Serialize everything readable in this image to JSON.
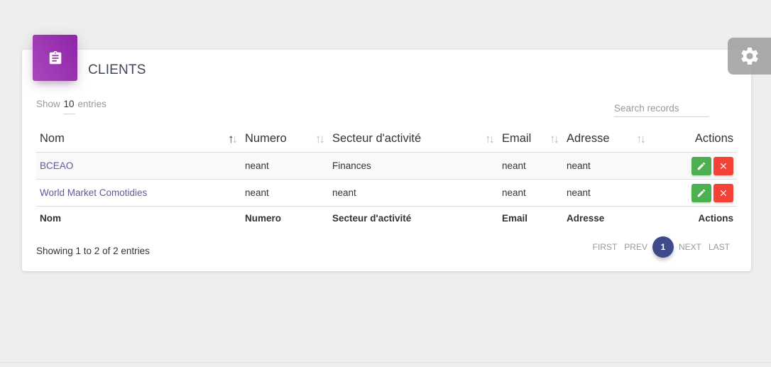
{
  "card": {
    "icon": "clipboard-icon",
    "title": "CLIENTS",
    "accent": "#9c27b0"
  },
  "settings": {
    "icon": "gear-icon"
  },
  "length": {
    "show_label": "Show",
    "value": "10",
    "entries_label": "entries"
  },
  "search": {
    "placeholder": "Search records",
    "value": ""
  },
  "table": {
    "columns": [
      "Nom",
      "Numero",
      "Secteur d'activité",
      "Email",
      "Adresse",
      "Actions"
    ],
    "rows": [
      [
        "BCEAO",
        "neant",
        "Finances",
        "neant",
        "neant"
      ],
      [
        "World Market Comotidies",
        "neant",
        "neant",
        "neant",
        "neant"
      ]
    ],
    "footer": [
      "Nom",
      "Numero",
      "Secteur d'activité",
      "Email",
      "Adresse",
      "Actions"
    ],
    "row_actions": {
      "edit_icon": "pencil-icon",
      "edit_color": "#4caf50",
      "delete_icon": "close-icon",
      "delete_color": "#f44336"
    }
  },
  "info": "Showing 1 to 2 of 2 entries",
  "pagination": {
    "first": "FIRST",
    "prev": "PREV",
    "current": "1",
    "next": "NEXT",
    "last": "LAST",
    "active_color": "#3f4a8a"
  }
}
